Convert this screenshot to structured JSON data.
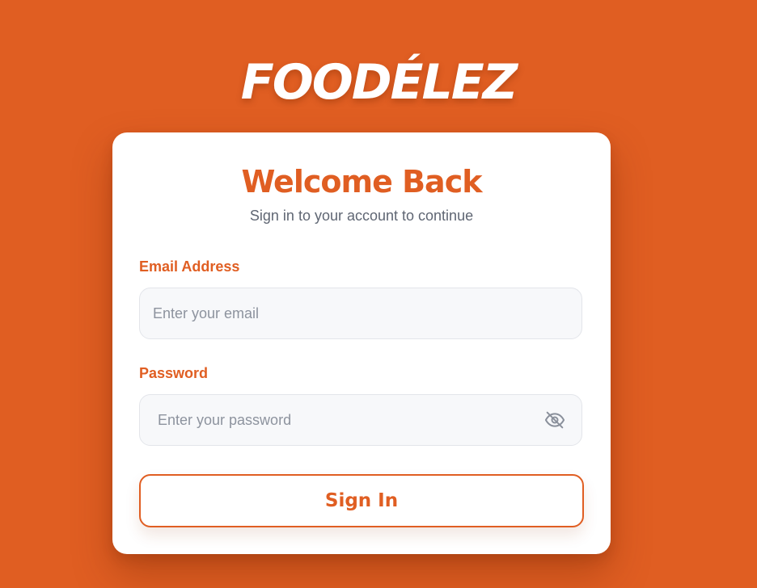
{
  "brand": {
    "logo_text": "FOODÉLEZ"
  },
  "login": {
    "title": "Welcome Back",
    "subtitle": "Sign in to your account to continue",
    "email_label": "Email Address",
    "email_value": "",
    "email_placeholder": "Enter your email",
    "password_label": "Password",
    "password_value": "",
    "password_placeholder": "Enter your password",
    "toggle_icon": "eye-off-icon",
    "submit_label": "Sign In"
  },
  "colors": {
    "background": "#e05e22",
    "accent": "#e05e22",
    "card": "#ffffff",
    "subtitle_text": "#5f6673",
    "input_background": "#f7f8fa",
    "placeholder_text": "#8d939e"
  }
}
